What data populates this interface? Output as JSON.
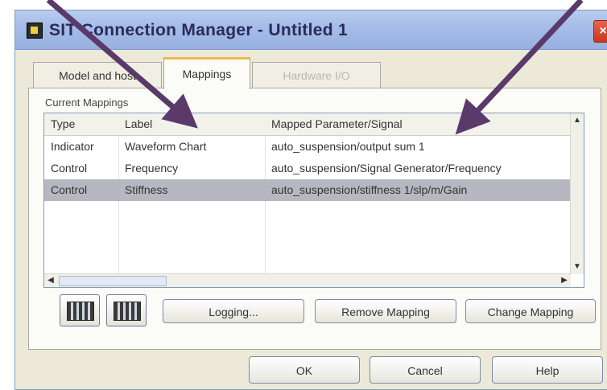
{
  "window": {
    "title": "SIT Connection Manager - Untitled 1",
    "close_symbol": "×"
  },
  "tabs": [
    {
      "label": "Model and host",
      "state": "normal"
    },
    {
      "label": "Mappings",
      "state": "selected"
    },
    {
      "label": "Hardware I/O",
      "state": "disabled"
    }
  ],
  "panel": {
    "section_label": "Current Mappings"
  },
  "table": {
    "headers": [
      "Type",
      "Label",
      "Mapped Parameter/Signal"
    ],
    "rows": [
      [
        "Indicator",
        "Waveform Chart",
        "auto_suspension/output sum 1"
      ],
      [
        "Control",
        "Frequency",
        "auto_suspension/Signal Generator/Frequency"
      ],
      [
        "Control",
        "Stiffness",
        "auto_suspension/stiffness 1/slp/m/Gain"
      ]
    ],
    "selected_row": 2,
    "scroll": {
      "up": "▲",
      "down": "▼",
      "left": "◀",
      "right": "▶"
    }
  },
  "buttons": {
    "logging": "Logging...",
    "remove_mapping": "Remove Mapping",
    "change_mapping": "Change Mapping",
    "ok": "OK",
    "cancel": "Cancel",
    "help": "Help"
  },
  "icons": {
    "app": "labview-app-icon",
    "close": "close-icon",
    "btn_a": "mapping-view-icon",
    "btn_b": "mapping-grid-icon"
  },
  "colors": {
    "selection": "#b7b7c2",
    "tab_highlight": "#f0b84a",
    "arrow": "#5a3a6a"
  }
}
